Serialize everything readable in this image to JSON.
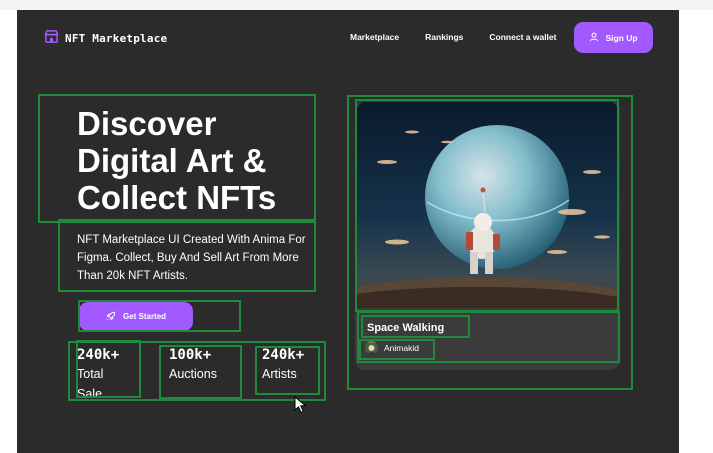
{
  "brand": {
    "name": "NFT Marketplace",
    "icon": "storefront-icon",
    "accent": "#a259ff"
  },
  "nav": {
    "links": [
      "Marketplace",
      "Rankings",
      "Connect a wallet"
    ],
    "signup_label": "Sign Up",
    "signup_icon": "user-icon"
  },
  "hero": {
    "title_lines": [
      "Discover",
      "Digital Art &",
      "Collect NFTs"
    ],
    "description_lines": [
      "NFT Marketplace UI Created With Anima For",
      "Figma. Collect, Buy And Sell Art From More",
      "Than 20k NFT Artists."
    ],
    "cta_label": "Get Started",
    "cta_icon": "rocket-icon"
  },
  "stats": [
    {
      "value": "240k+",
      "label": "Total Sale"
    },
    {
      "value": "100k+",
      "label": "Auctions"
    },
    {
      "value": "240k+",
      "label": "Artists"
    }
  ],
  "featured": {
    "title": "Space Walking",
    "artist": "Animakid",
    "image": "astronaut-planet-artwork"
  },
  "colors": {
    "background": "#2b2b2b",
    "card": "#3b3b3b",
    "highlight": "#1f8a3c"
  }
}
